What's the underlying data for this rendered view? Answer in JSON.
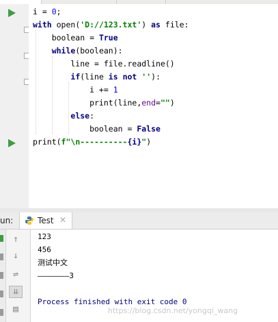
{
  "code_lines": [
    {
      "parts": [
        {
          "t": "i = ",
          "c": ""
        },
        {
          "t": "0",
          "c": "num"
        },
        {
          "t": ";",
          "c": ""
        }
      ]
    },
    {
      "parts": [
        {
          "t": "with",
          "c": "kw"
        },
        {
          "t": " open(",
          "c": ""
        },
        {
          "t": "'D://123.txt'",
          "c": "str"
        },
        {
          "t": ") ",
          "c": ""
        },
        {
          "t": "as",
          "c": "kw"
        },
        {
          "t": " file:",
          "c": ""
        }
      ]
    },
    {
      "parts": [
        {
          "t": "    boolean = ",
          "c": ""
        },
        {
          "t": "True",
          "c": "kw"
        }
      ]
    },
    {
      "parts": [
        {
          "t": "    ",
          "c": ""
        },
        {
          "t": "while",
          "c": "kw"
        },
        {
          "t": "(boolean):",
          "c": ""
        }
      ]
    },
    {
      "parts": [
        {
          "t": "        line = file.readline()",
          "c": ""
        }
      ]
    },
    {
      "parts": [
        {
          "t": "        ",
          "c": ""
        },
        {
          "t": "if",
          "c": "kw"
        },
        {
          "t": "(line ",
          "c": ""
        },
        {
          "t": "is not",
          "c": "kw"
        },
        {
          "t": " ",
          "c": ""
        },
        {
          "t": "''",
          "c": "str"
        },
        {
          "t": "):",
          "c": ""
        }
      ]
    },
    {
      "parts": [
        {
          "t": "            i += ",
          "c": ""
        },
        {
          "t": "1",
          "c": "num"
        }
      ]
    },
    {
      "parts": [
        {
          "t": "            print(line,",
          "c": ""
        },
        {
          "t": "end",
          "c": "param"
        },
        {
          "t": "=",
          "c": ""
        },
        {
          "t": "\"\"",
          "c": "str"
        },
        {
          "t": ")",
          "c": ""
        }
      ]
    },
    {
      "parts": [
        {
          "t": "        ",
          "c": ""
        },
        {
          "t": "else",
          "c": "kw"
        },
        {
          "t": ":",
          "c": ""
        }
      ]
    },
    {
      "parts": [
        {
          "t": "            boolean = ",
          "c": ""
        },
        {
          "t": "False",
          "c": "kw"
        }
      ]
    },
    {
      "parts": [
        {
          "t": "print(",
          "c": ""
        },
        {
          "t": "f\"\\n----------",
          "c": "str"
        },
        {
          "t": "{i}",
          "c": "kw"
        },
        {
          "t": "\"",
          "c": "str"
        },
        {
          "t": ")",
          "c": ""
        }
      ]
    }
  ],
  "run_panel": {
    "label": "un:",
    "tab_label": "Test",
    "close_glyph": "✕"
  },
  "console_lines": [
    "123",
    "456",
    "测试中文",
    "———————3",
    "",
    "Process finished with exit code 0"
  ],
  "watermark": "https://blog.csdn.net/yongqi_wang",
  "toolbar_icons": [
    "arrow-up-icon",
    "arrow-down-icon",
    "soft-wrap-icon",
    "scroll-to-end-icon",
    "print-icon"
  ],
  "colors": {
    "keyword": "#000080",
    "string": "#008000",
    "number": "#0000ff",
    "param": "#660099",
    "run_green": "#3d9e3d"
  }
}
